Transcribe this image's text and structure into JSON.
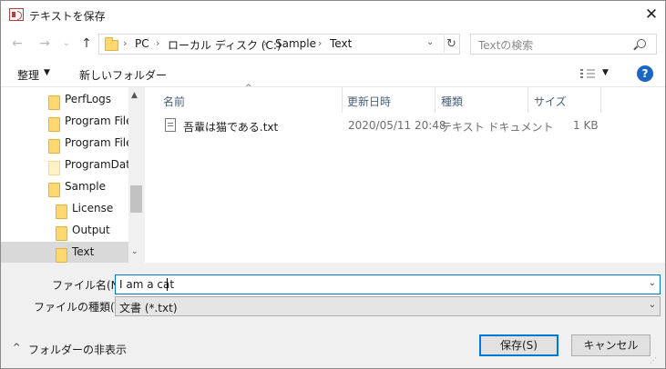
{
  "window": {
    "title": "テキストを保存",
    "close_glyph": "✕"
  },
  "navigation": {
    "back_glyph": "←",
    "forward_glyph": "→",
    "recent_glyph": "⌄",
    "up_glyph": "↑",
    "breadcrumbs": [
      "PC",
      "ローカル ディスク (C:)",
      "Sample",
      "Text"
    ],
    "crumb_separator": "›",
    "dropdown_glyph": "⌄",
    "refresh_glyph": "↻",
    "search_placeholder": "Textの検索"
  },
  "toolbar": {
    "organize_label": "整理",
    "organize_caret": "▼",
    "new_folder_label": "新しいフォルダー",
    "view_caret": "▼",
    "help_label": "?"
  },
  "tree": {
    "items": [
      {
        "label": "PerfLogs",
        "icon": "folder-icon"
      },
      {
        "label": "Program Files",
        "icon": "folder-icon"
      },
      {
        "label": "Program Files",
        "icon": "folder-icon"
      },
      {
        "label": "ProgramData",
        "icon": "folder-icon"
      },
      {
        "label": "Sample",
        "icon": "folder-icon"
      },
      {
        "label": "License",
        "icon": "folder-icon"
      },
      {
        "label": "Output",
        "icon": "folder-icon"
      },
      {
        "label": "Text",
        "icon": "folder-icon",
        "selected": true
      }
    ],
    "scroll_up_glyph": "▲",
    "scroll_down_glyph": "⌄"
  },
  "file_list": {
    "columns": [
      "名前",
      "更新日時",
      "種類",
      "サイズ"
    ],
    "sort_glyph": "^",
    "rows": [
      {
        "name": "吾輩は猫である.txt",
        "modified": "2020/05/11 20:48",
        "type": "テキスト ドキュメント",
        "size": "1 KB"
      }
    ]
  },
  "form": {
    "filename_label": "ファイル名(N):",
    "filename_value": "I am a cat",
    "filetype_label": "ファイルの種類(T):",
    "filetype_value": "文書 (*.txt)",
    "combo_glyph": "⌄",
    "hide_folders_label": "フォルダーの非表示",
    "hide_folders_caret": "^",
    "save_label": "保存(S)",
    "cancel_label": "キャンセル"
  },
  "colors": {
    "accent": "#0078d7",
    "selection": "#cce8ff",
    "folder": "#ffd970",
    "help": "#1a66c7"
  }
}
